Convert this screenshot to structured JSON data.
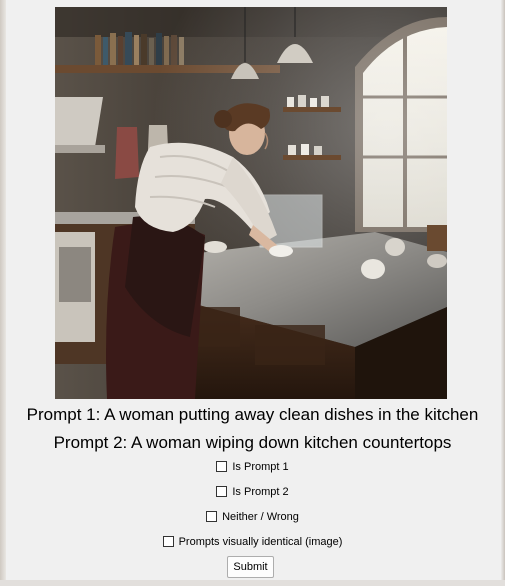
{
  "prompts": {
    "prompt1": "Prompt 1: A woman putting away clean dishes in the kitchen",
    "prompt2": "Prompt 2: A woman wiping down kitchen countertops"
  },
  "options": [
    {
      "label": "Is Prompt 1",
      "checked": false
    },
    {
      "label": "Is Prompt 2",
      "checked": false
    },
    {
      "label": "Neither / Wrong",
      "checked": false
    },
    {
      "label": "Prompts visually identical (image)",
      "checked": false
    }
  ],
  "submit_label": "Submit",
  "colors": {
    "background": "#f0f0f0",
    "text": "#000000",
    "button_border": "#adadad"
  }
}
